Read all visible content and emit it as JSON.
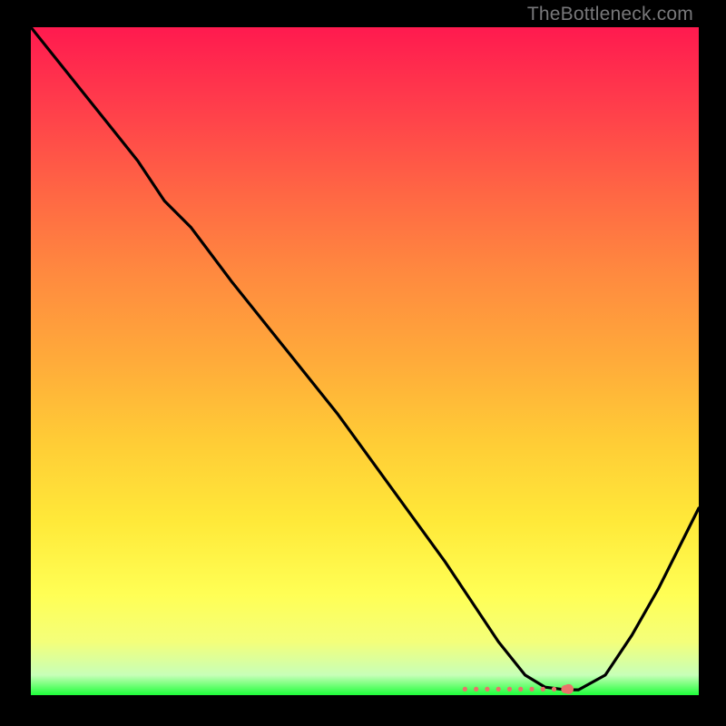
{
  "watermark": "TheBottleneck.com",
  "chart_data": {
    "type": "line",
    "title": "",
    "xlabel": "",
    "ylabel": "",
    "xlim": [
      0,
      100
    ],
    "ylim": [
      0,
      100
    ],
    "grid": false,
    "legend": false,
    "background": "rainbow-gradient-vertical",
    "series": [
      {
        "name": "bottleneck-curve",
        "x": [
          0,
          8,
          16,
          20,
          24,
          30,
          38,
          46,
          54,
          62,
          66,
          70,
          74,
          77,
          80,
          82,
          86,
          90,
          94,
          100
        ],
        "y": [
          100,
          90,
          80,
          74,
          70,
          62,
          52,
          42,
          31,
          20,
          14,
          8,
          3,
          1.2,
          0.8,
          0.8,
          3,
          9,
          16,
          28
        ]
      }
    ],
    "markers": [
      {
        "name": "flat-cluster",
        "x_range": [
          65,
          80
        ],
        "y": 0.9
      },
      {
        "name": "point",
        "x": 80.5,
        "y": 0.9
      }
    ]
  }
}
